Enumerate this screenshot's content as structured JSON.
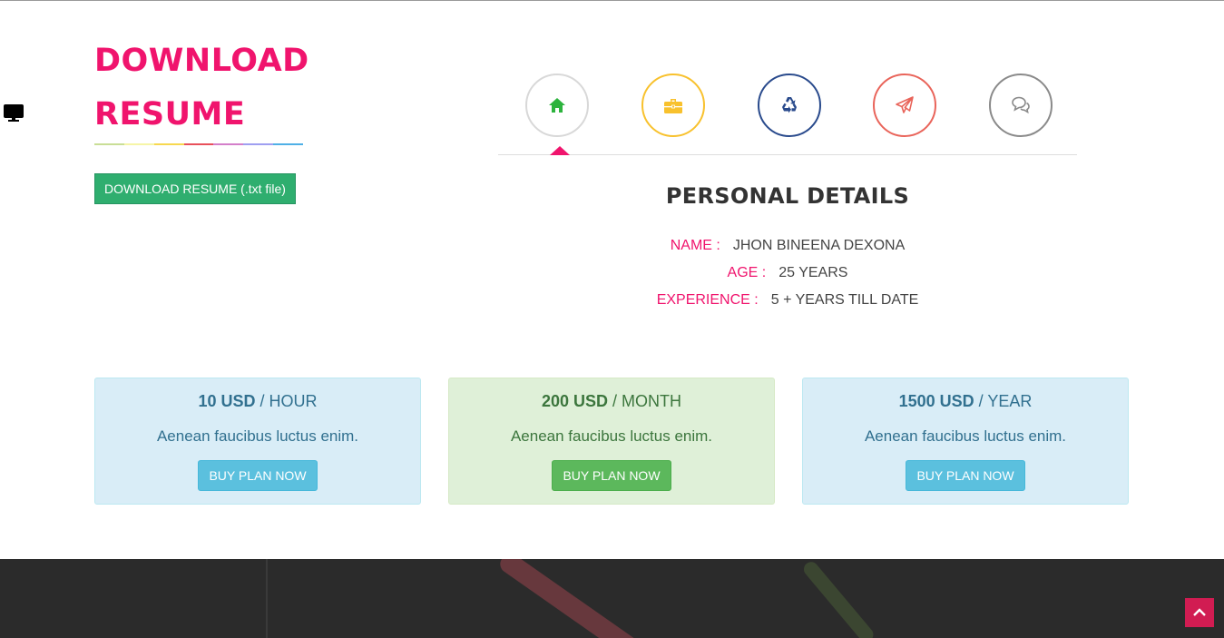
{
  "resume": {
    "title_line1": "DOWNLOAD",
    "title_line2": "RESUME",
    "download_button": "DOWNLOAD RESUME (.txt file)"
  },
  "rainbow_colors": [
    "#c9de96",
    "#f6f5a7",
    "#f7d84f",
    "#e8505b",
    "#d47fca",
    "#9f9ff1",
    "#4fb0e6"
  ],
  "tabs": [
    {
      "name": "home",
      "icon": "home-icon",
      "color": "#2db33d",
      "border": "#d8d8d8"
    },
    {
      "name": "briefcase",
      "icon": "briefcase-icon",
      "color": "#f8c12d",
      "border": "#f8c12d"
    },
    {
      "name": "recycle",
      "icon": "recycle-icon",
      "color": "#294a8c",
      "border": "#294a8c"
    },
    {
      "name": "send",
      "icon": "paper-plane-icon",
      "color": "#e9645a",
      "border": "#e9645a"
    },
    {
      "name": "comments",
      "icon": "comments-icon",
      "color": "#8a8a8a",
      "border": "#8a8a8a"
    }
  ],
  "personal": {
    "heading": "PERSONAL DETAILS",
    "name_label": "NAME :",
    "name_value": "JHON BINEENA DEXONA",
    "age_label": "AGE :",
    "age_value": "25 YEARS",
    "exp_label": "EXPERIENCE :",
    "exp_value": "5 + YEARS TILL DATE"
  },
  "plans": [
    {
      "amount": "10 USD",
      "period": " / HOUR",
      "desc": "Aenean faucibus luctus enim.",
      "button": "BUY PLAN NOW"
    },
    {
      "amount": "200 USD",
      "period": " / MONTH",
      "desc": "Aenean faucibus luctus enim.",
      "button": "BUY PLAN NOW"
    },
    {
      "amount": "1500 USD",
      "period": " / YEAR",
      "desc": "Aenean faucibus luctus enim.",
      "button": "BUY PLAN NOW"
    }
  ],
  "accent_color": "#f0146d"
}
